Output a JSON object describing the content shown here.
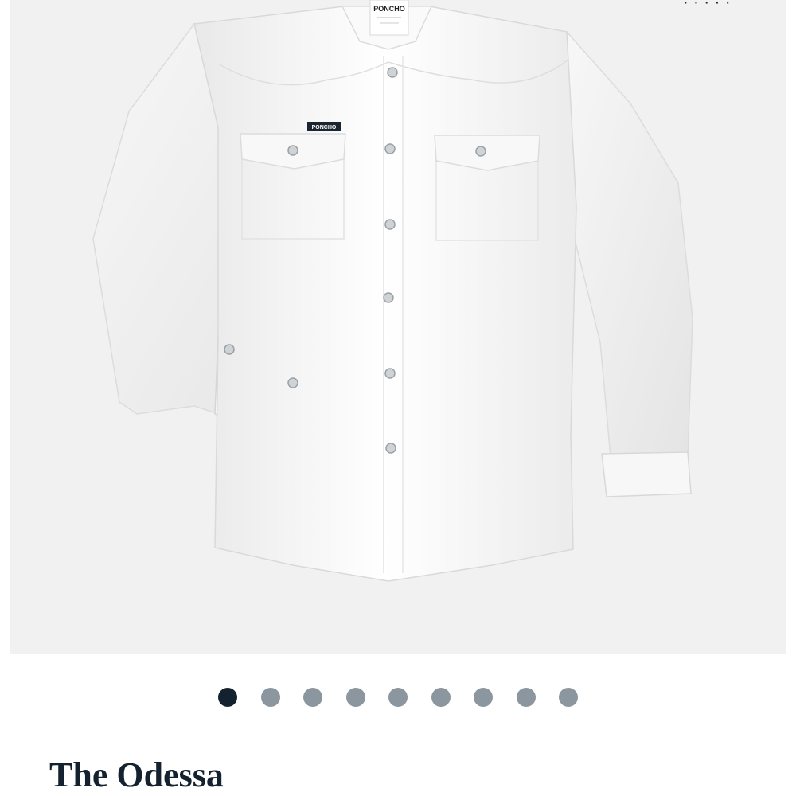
{
  "product": {
    "title": "The Odessa",
    "image_alt": "White long-sleeve western snap shirt",
    "collar_label_brand": "PONCHO",
    "chest_tag_brand": "PONCHO"
  },
  "carousel": {
    "total_slides": 9,
    "active_index": 0
  },
  "colors": {
    "image_background": "#f1f1f1",
    "dot_active": "#14222f",
    "dot_inactive": "#8b969e",
    "title": "#14222f"
  }
}
